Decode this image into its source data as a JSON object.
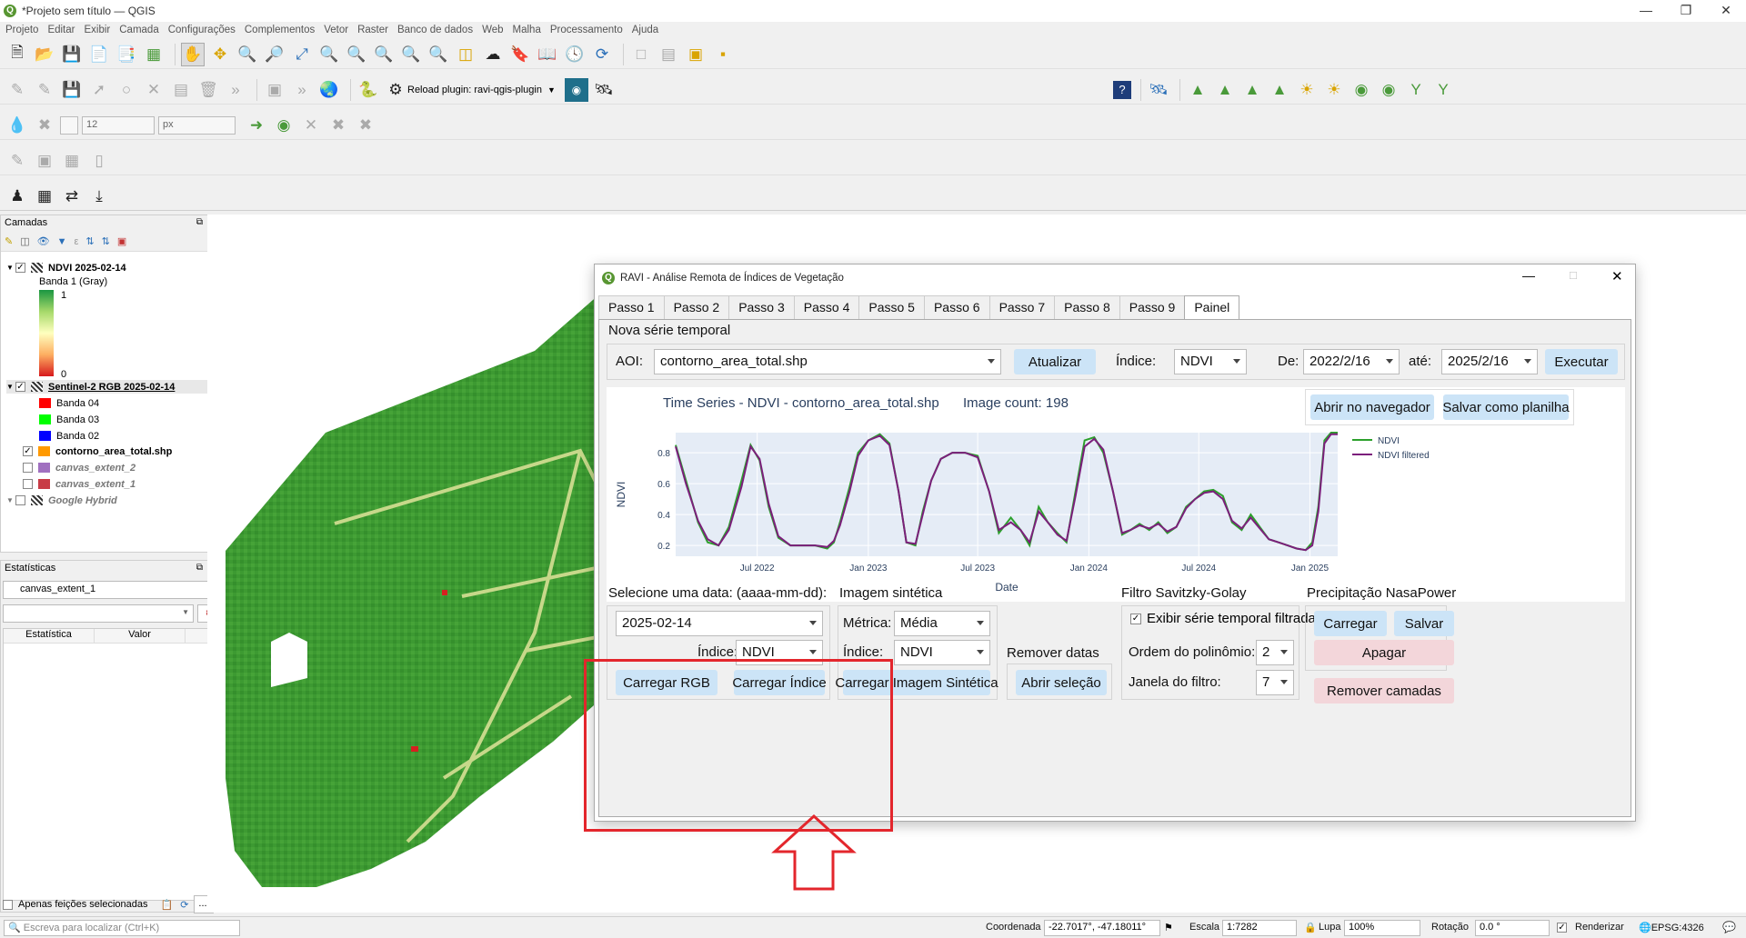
{
  "window": {
    "title": "*Projeto sem título — QGIS"
  },
  "menu": [
    "Projeto",
    "Editar",
    "Exibir",
    "Camada",
    "Configurações",
    "Complementos",
    "Vetor",
    "Raster",
    "Banco de dados",
    "Web",
    "Malha",
    "Processamento",
    "Ajuda"
  ],
  "toolbar": {
    "reload_plugin_label": "Reload plugin: ravi-qgis-plugin",
    "snap_tolerance_value": "12",
    "snap_units": "px"
  },
  "layers_panel": {
    "title": "Camadas",
    "layers": [
      {
        "name": "NDVI 2025-02-14",
        "checked": true,
        "bold": true
      },
      {
        "name": "Banda 1 (Gray)"
      },
      {
        "name": "1"
      },
      {
        "name": "0"
      },
      {
        "name": "Sentinel-2 RGB 2025-02-14",
        "checked": true,
        "bold": true
      },
      {
        "name": "Banda 04",
        "color": "#ff0000"
      },
      {
        "name": "Banda 03",
        "color": "#00ff00"
      },
      {
        "name": "Banda 02",
        "color": "#0000ff"
      },
      {
        "name": "contorno_area_total.shp",
        "checked": true,
        "bold": true,
        "color": "#ff9900"
      },
      {
        "name": "canvas_extent_2",
        "checked": false,
        "color": "#a070c0"
      },
      {
        "name": "canvas_extent_1",
        "checked": false,
        "color": "#c83c46"
      },
      {
        "name": "Google Hybrid",
        "checked": false
      }
    ]
  },
  "stats_panel": {
    "title": "Estatísticas",
    "layer": "canvas_extent_1",
    "col_stat": "Estatística",
    "col_value": "Valor",
    "only_selected_label": "Apenas feições selecionadas"
  },
  "dialog": {
    "title": "RAVI - Análise Remota de Índices de Vegetação",
    "tabs": [
      "Passo 1",
      "Passo 2",
      "Passo 3",
      "Passo 4",
      "Passo 5",
      "Passo 6",
      "Passo 7",
      "Passo 8",
      "Passo 9",
      "Painel"
    ],
    "active_tab": "Painel",
    "section_title": "Nova série temporal",
    "aoi_label": "AOI:",
    "aoi_value": "contorno_area_total.shp",
    "update_button": "Atualizar",
    "index_label": "Índice:",
    "index_value": "NDVI",
    "from_label": "De:",
    "from_value": "2022/2/16",
    "to_label": "até:",
    "to_value": "2025/2/16",
    "run_button": "Executar",
    "chart_title": "Time Series - NDVI - contorno_area_total.shp",
    "image_count": "Image count: 198",
    "open_browser_button": "Abrir no navegador",
    "save_sheet_button": "Salvar como planilha",
    "select_date_label": "Selecione uma data: (aaaa-mm-dd):",
    "date_value": "2025-02-14",
    "index2_label": "Índice:",
    "index2_value": "NDVI",
    "load_rgb_button": "Carregar RGB",
    "load_index_button": "Carregar Índice",
    "synthetic_title": "Imagem sintética",
    "metric_label": "Métrica:",
    "metric_value": "Média",
    "index3_label": "Índice:",
    "index3_value": "NDVI",
    "load_synthetic_button": "Carregar Imagem Sintética",
    "remove_dates_label": "Remover datas",
    "open_selection_button": "Abrir seleção",
    "sg_title": "Filtro Savitzky-Golay",
    "show_filtered_label": "Exibir série temporal filtrada",
    "poly_order_label": "Ordem do polinômio:",
    "poly_order_value": "2",
    "window_label": "Janela do filtro:",
    "window_value": "7",
    "precip_title": "Precipitação NasaPower",
    "load_button": "Carregar",
    "save_button": "Salvar",
    "delete_button": "Apagar",
    "remove_layers_button": "Remover camadas"
  },
  "chart_data": {
    "type": "line",
    "title": "",
    "xlabel": "Date",
    "ylabel": "NDVI",
    "ylim": [
      0.13,
      0.93
    ],
    "xlim": [
      "2022-02-16",
      "2025-02-16"
    ],
    "x_ticks": [
      "Jul 2022",
      "Jan 2023",
      "Jul 2023",
      "Jan 2024",
      "Jul 2024",
      "Jan 2025"
    ],
    "y_ticks": [
      "0.2",
      "0.4",
      "0.6",
      "0.8"
    ],
    "legend_position": "top-right",
    "series": [
      {
        "name": "NDVI",
        "color": "#2ca02c",
        "x": [
          "2022-02-16",
          "2022-03-05",
          "2022-03-25",
          "2022-04-10",
          "2022-04-28",
          "2022-05-15",
          "2022-06-05",
          "2022-06-20",
          "2022-07-05",
          "2022-07-20",
          "2022-08-05",
          "2022-08-25",
          "2022-09-15",
          "2022-10-05",
          "2022-10-25",
          "2022-11-05",
          "2022-11-15",
          "2022-12-01",
          "2022-12-15",
          "2023-01-01",
          "2023-01-20",
          "2023-02-05",
          "2023-02-20",
          "2023-03-05",
          "2023-03-20",
          "2023-04-01",
          "2023-04-15",
          "2023-05-01",
          "2023-05-20",
          "2023-06-10",
          "2023-07-01",
          "2023-07-20",
          "2023-08-05",
          "2023-08-25",
          "2023-09-10",
          "2023-09-25",
          "2023-10-10",
          "2023-10-25",
          "2023-11-10",
          "2023-11-25",
          "2023-12-10",
          "2023-12-25",
          "2024-01-10",
          "2024-01-25",
          "2024-02-10",
          "2024-02-25",
          "2024-03-10",
          "2024-03-25",
          "2024-04-10",
          "2024-04-25",
          "2024-05-10",
          "2024-05-25",
          "2024-06-10",
          "2024-06-25",
          "2024-07-10",
          "2024-07-25",
          "2024-08-10",
          "2024-08-25",
          "2024-09-10",
          "2024-09-25",
          "2024-10-10",
          "2024-10-25",
          "2024-11-10",
          "2024-11-25",
          "2024-12-10",
          "2024-12-25",
          "2025-01-05",
          "2025-01-15",
          "2025-01-25",
          "2025-02-05",
          "2025-02-16"
        ],
        "y": [
          0.85,
          0.62,
          0.35,
          0.22,
          0.2,
          0.32,
          0.62,
          0.85,
          0.75,
          0.45,
          0.25,
          0.2,
          0.2,
          0.2,
          0.18,
          0.22,
          0.35,
          0.58,
          0.8,
          0.88,
          0.92,
          0.86,
          0.55,
          0.22,
          0.2,
          0.42,
          0.62,
          0.76,
          0.8,
          0.8,
          0.78,
          0.55,
          0.28,
          0.38,
          0.3,
          0.2,
          0.45,
          0.35,
          0.28,
          0.22,
          0.55,
          0.88,
          0.9,
          0.8,
          0.55,
          0.27,
          0.3,
          0.34,
          0.3,
          0.35,
          0.28,
          0.32,
          0.45,
          0.5,
          0.55,
          0.56,
          0.52,
          0.35,
          0.3,
          0.4,
          0.32,
          0.24,
          0.22,
          0.2,
          0.18,
          0.17,
          0.22,
          0.45,
          0.88,
          0.93,
          0.93
        ]
      },
      {
        "name": "NDVI filtered",
        "color": "#7b1f7b",
        "x": [
          "2022-02-16",
          "2022-03-05",
          "2022-03-25",
          "2022-04-10",
          "2022-04-28",
          "2022-05-15",
          "2022-06-05",
          "2022-06-20",
          "2022-07-05",
          "2022-07-20",
          "2022-08-05",
          "2022-08-25",
          "2022-09-15",
          "2022-10-05",
          "2022-10-25",
          "2022-11-05",
          "2022-11-15",
          "2022-12-01",
          "2022-12-15",
          "2023-01-01",
          "2023-01-20",
          "2023-02-05",
          "2023-02-20",
          "2023-03-05",
          "2023-03-20",
          "2023-04-01",
          "2023-04-15",
          "2023-05-01",
          "2023-05-20",
          "2023-06-10",
          "2023-07-01",
          "2023-07-20",
          "2023-08-05",
          "2023-08-25",
          "2023-09-10",
          "2023-09-25",
          "2023-10-10",
          "2023-10-25",
          "2023-11-10",
          "2023-11-25",
          "2023-12-10",
          "2023-12-25",
          "2024-01-10",
          "2024-01-25",
          "2024-02-10",
          "2024-02-25",
          "2024-03-10",
          "2024-03-25",
          "2024-04-10",
          "2024-04-25",
          "2024-05-10",
          "2024-05-25",
          "2024-06-10",
          "2024-06-25",
          "2024-07-10",
          "2024-07-25",
          "2024-08-10",
          "2024-08-25",
          "2024-09-10",
          "2024-09-25",
          "2024-10-10",
          "2024-10-25",
          "2024-11-10",
          "2024-11-25",
          "2024-12-10",
          "2024-12-25",
          "2025-01-05",
          "2025-01-15",
          "2025-01-25",
          "2025-02-05",
          "2025-02-16"
        ],
        "y": [
          0.84,
          0.6,
          0.36,
          0.24,
          0.2,
          0.3,
          0.58,
          0.84,
          0.76,
          0.47,
          0.26,
          0.2,
          0.2,
          0.2,
          0.19,
          0.23,
          0.33,
          0.55,
          0.78,
          0.88,
          0.91,
          0.85,
          0.55,
          0.22,
          0.21,
          0.4,
          0.62,
          0.76,
          0.8,
          0.8,
          0.77,
          0.55,
          0.3,
          0.35,
          0.3,
          0.22,
          0.42,
          0.35,
          0.27,
          0.23,
          0.52,
          0.84,
          0.89,
          0.82,
          0.55,
          0.28,
          0.3,
          0.33,
          0.31,
          0.34,
          0.29,
          0.32,
          0.44,
          0.5,
          0.54,
          0.55,
          0.5,
          0.36,
          0.31,
          0.38,
          0.31,
          0.24,
          0.22,
          0.2,
          0.18,
          0.17,
          0.2,
          0.42,
          0.86,
          0.92,
          0.92
        ]
      }
    ]
  }
}
